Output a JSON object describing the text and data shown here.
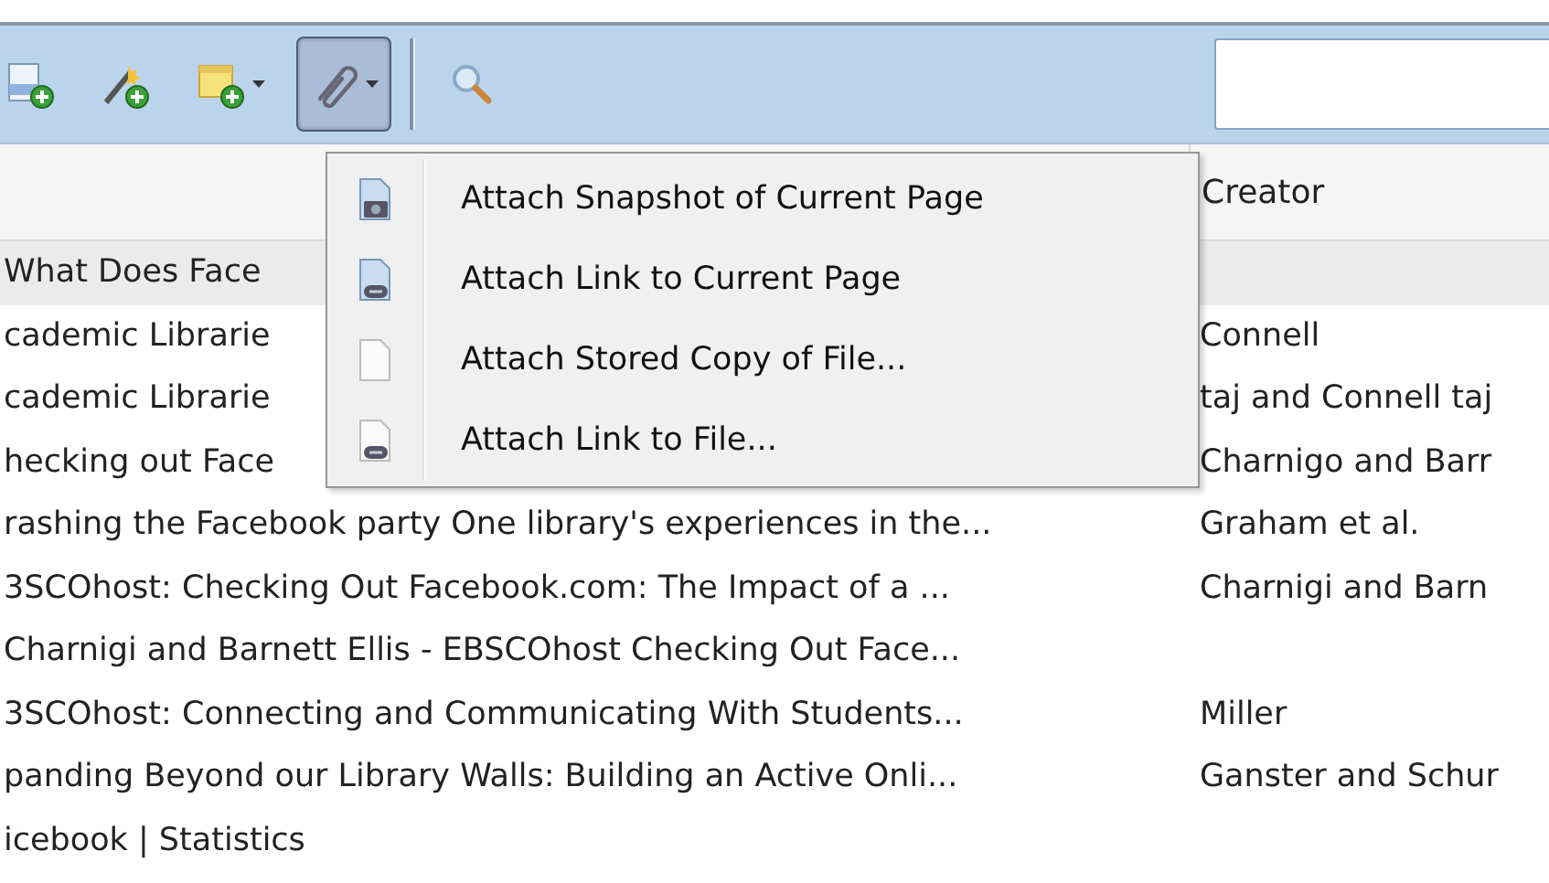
{
  "toolbar": {
    "buttons": [
      {
        "kind": "new-item",
        "dropdown": false,
        "pressed": false
      },
      {
        "kind": "wand",
        "dropdown": false,
        "pressed": false
      },
      {
        "kind": "note",
        "dropdown": true,
        "pressed": false
      },
      {
        "kind": "attach",
        "dropdown": true,
        "pressed": true
      },
      {
        "kind": "search",
        "dropdown": false,
        "pressed": false
      }
    ]
  },
  "header": {
    "column_2": "Creator"
  },
  "rows": [
    {
      "title": "What Does Face",
      "selected": true
    },
    {
      "title": "cademic Librarie",
      "creator": "Connell",
      "selected": false
    },
    {
      "title": "cademic Librarie",
      "creator": "taj and Connell taj",
      "selected": false
    },
    {
      "title": "hecking out Face",
      "creator": "Charnigo and Barr",
      "selected": false
    },
    {
      "title": "rashing the Facebook party One library's experiences in the...",
      "creator": "Graham et al.",
      "selected": false
    },
    {
      "title": "3SCOhost: Checking Out Facebook.com: The Impact of a ...",
      "creator": "Charnigi and Barn",
      "selected": false
    },
    {
      "title": "Charnigi and Barnett Ellis - EBSCOhost Checking Out Face...",
      "selected": false
    },
    {
      "title": "3SCOhost: Connecting and Communicating With Students...",
      "creator": "Miller",
      "selected": false
    },
    {
      "title": "panding Beyond our Library Walls: Building an Active Onli...",
      "creator": "Ganster and Schur",
      "selected": false
    },
    {
      "title": "icebook | Statistics",
      "selected": false
    }
  ],
  "menu": {
    "items": [
      {
        "kind": "snapshot",
        "label": "Attach Snapshot of Current Page"
      },
      {
        "kind": "link-page",
        "label": "Attach Link to Current Page"
      },
      {
        "kind": "file",
        "label": "Attach Stored Copy of File..."
      },
      {
        "kind": "link-file",
        "label": "Attach Link to File..."
      }
    ]
  }
}
